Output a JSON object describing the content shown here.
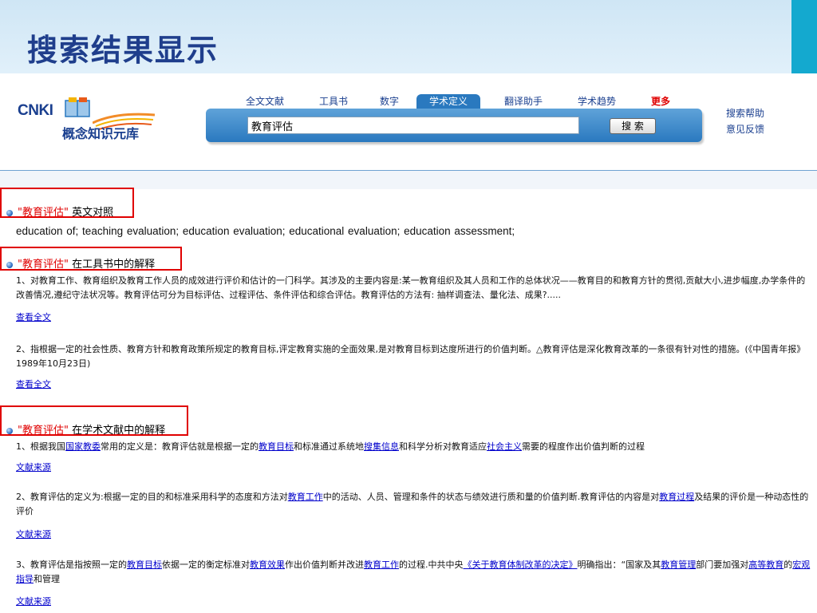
{
  "slide_title": "搜索结果显示",
  "logo": {
    "brand": "CNKI",
    "subtitle": "概念知识元库"
  },
  "tabs": [
    {
      "label": "全文文献"
    },
    {
      "label": "工具书"
    },
    {
      "label": "数字"
    },
    {
      "label": "学术定义",
      "active": true
    },
    {
      "label": "翻译助手"
    },
    {
      "label": "学术趋势"
    },
    {
      "label": "更多"
    }
  ],
  "search": {
    "value": "教育评估",
    "button": "搜 索"
  },
  "side_links": {
    "help": "搜索帮助",
    "feedback": "意见反馈"
  },
  "sections": {
    "english": {
      "term": "\"教育评估\"",
      "title_rest": " 英文对照",
      "terms": "education of;   teaching evaluation;   education evaluation;   educational evaluation;   education assessment;"
    },
    "toolbook": {
      "term": "\"教育评估\"",
      "title_rest": " 在工具书中的解释",
      "items": [
        {
          "text": "1、对教育工作、教育组织及教育工作人员的成效进行评价和估计的一门科学。其涉及的主要内容是:某一教育组织及其人员和工作的总体状况——教育目的和教育方针的贯彻,贡献大小,进步幅度,办学条件的改善情况,遵纪守法状况等。教育评估可分为目标评估、过程评估、条件评估和综合评估。教育评估的方法有: 抽样调查法、量化法、成果?.....",
          "link": "查看全文"
        },
        {
          "text": "2、指根据一定的社会性质、教育方针和教育政策所规定的教育目标,评定教育实施的全面效果,是对教育目标到达度所进行的价值判断。△教育评估是深化教育改革的一条很有针对性的措施。(《中国青年报》1989年10月23日)",
          "link": "查看全文"
        }
      ]
    },
    "academic": {
      "term": "\"教育评估\"",
      "title_rest": " 在学术文献中的解释",
      "items": [
        {
          "parts": [
            "1、根据我国",
            "国家教委",
            "常用的定义是：教育评估就是根据一定的",
            "教育目标",
            "和标准通过系统地",
            "搜集信息",
            "和科学分析对教育适应",
            "社会主义",
            "需要的程度作出价值判断的过程"
          ],
          "link": "文献来源"
        },
        {
          "parts": [
            "2、教育评估的定义为:根据一定的目的和标准采用科学的态度和方法对",
            "教育工作",
            "中的活动、人员、管理和条件的状态与绩效进行质和量的价值判断.教育评估的内容是对",
            "教育过程",
            "及结果的评价是一种动态性的评价"
          ],
          "link": "文献来源"
        },
        {
          "parts": [
            "3、教育评估是指按照一定的",
            "教育目标",
            "依据一定的衡定标准对",
            "教育效果",
            "作出价值判断并改进",
            "教育工作",
            "的过程.中共中央",
            "《关于教育体制改革的决定》",
            "明确指出：“国家及其",
            "教育管理",
            "部门要加强对",
            "高等教育",
            "的",
            "宏观指导",
            "和管理"
          ],
          "link": "文献来源"
        }
      ]
    }
  }
}
